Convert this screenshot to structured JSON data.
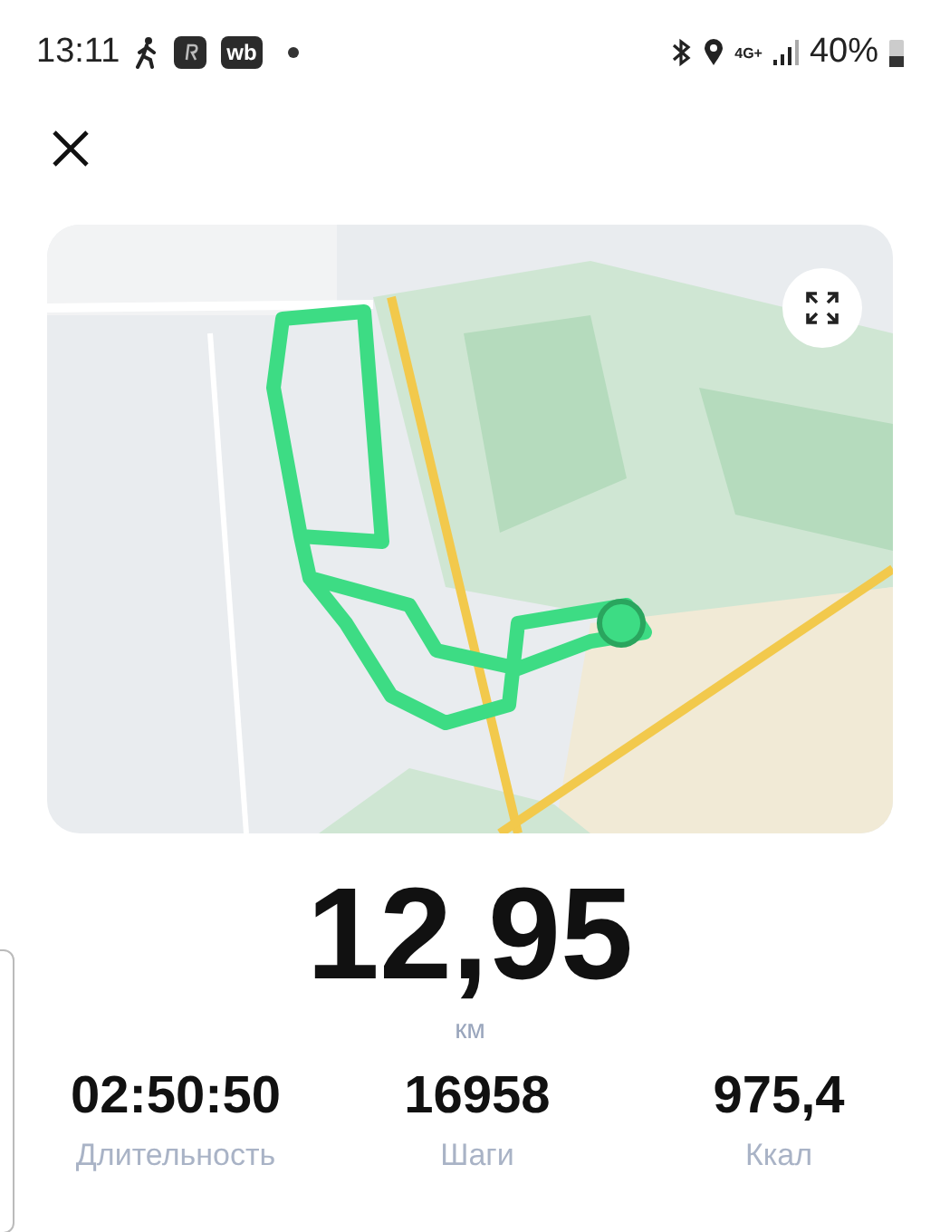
{
  "status_bar": {
    "time": "13:11",
    "app_badge": "wb",
    "network": "4G+",
    "battery": "40%"
  },
  "distance": {
    "value": "12,95",
    "unit": "км"
  },
  "stats": [
    {
      "value": "02:50:50",
      "label": "Длительность"
    },
    {
      "value": "16958",
      "label": "Шаги"
    },
    {
      "value": "975,4",
      "label": "Ккал"
    }
  ]
}
